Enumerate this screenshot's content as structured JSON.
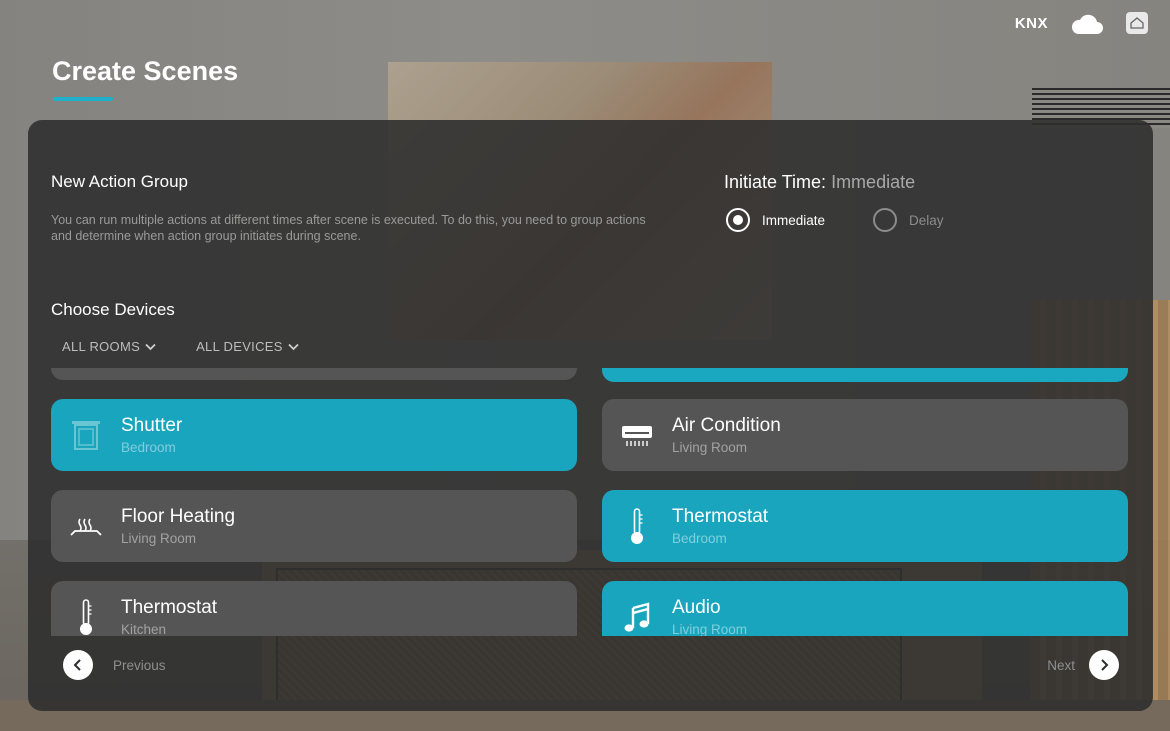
{
  "status_bar": {
    "knx_label": "KNX",
    "icons": [
      "cloud-icon",
      "home-icon"
    ]
  },
  "page": {
    "title": "Create Scenes",
    "accent_color": "#1eb1c9"
  },
  "action_group": {
    "title": "New Action Group",
    "description": "You can run multiple actions at different times after scene is executed. To do this, you need to group actions and determine when action group initiates during scene."
  },
  "initiate_time": {
    "label": "Initiate Time:",
    "value": "Immediate",
    "options": [
      {
        "label": "Immediate",
        "selected": true
      },
      {
        "label": "Delay",
        "selected": false
      }
    ]
  },
  "devices": {
    "title": "Choose Devices",
    "filters": [
      {
        "label": "ALL ROOMS",
        "icon": "chevron-down-icon"
      },
      {
        "label": "ALL DEVICES",
        "icon": "chevron-down-icon"
      }
    ],
    "items": [
      {
        "name": "Shutter",
        "room": "Bedroom",
        "icon": "shutter-icon",
        "selected": true
      },
      {
        "name": "Air Condition",
        "room": "Living Room",
        "icon": "air-condition-icon",
        "selected": false
      },
      {
        "name": "Floor Heating",
        "room": "Living Room",
        "icon": "floor-heating-icon",
        "selected": false
      },
      {
        "name": "Thermostat",
        "room": "Bedroom",
        "icon": "thermostat-icon",
        "selected": true
      },
      {
        "name": "Thermostat",
        "room": "Kitchen",
        "icon": "thermostat-icon",
        "selected": false
      },
      {
        "name": "Audio",
        "room": "Living Room",
        "icon": "audio-icon",
        "selected": true
      }
    ]
  },
  "navigation": {
    "previous_label": "Previous",
    "next_label": "Next"
  },
  "colors": {
    "selected_card": "#1aa5be",
    "unselected_card": "#555555",
    "panel": "#2d2d2d"
  }
}
